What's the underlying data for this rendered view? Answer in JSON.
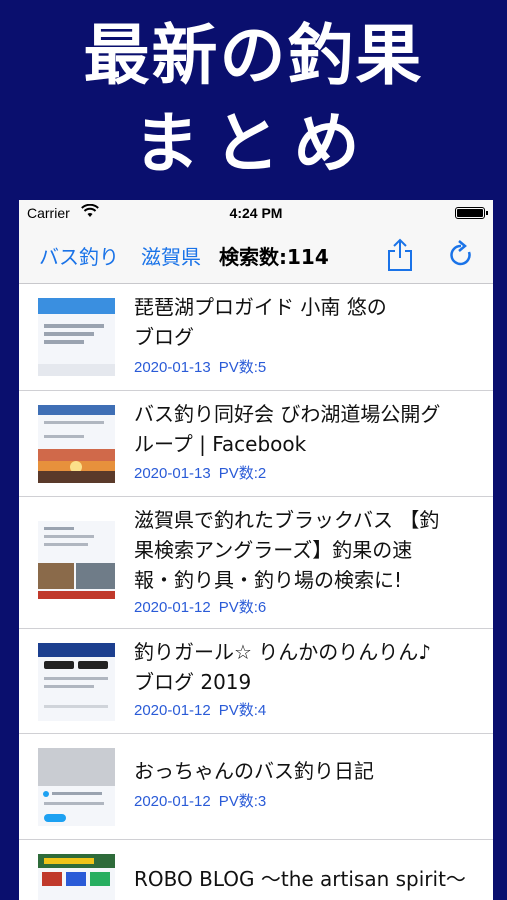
{
  "promo": {
    "line1": "最新の釣果",
    "line2": "まとめ"
  },
  "status_bar": {
    "carrier": "Carrier",
    "time": "4:24 PM"
  },
  "nav": {
    "category": "バス釣り",
    "prefecture": "滋賀県",
    "count_label": "検索数:114"
  },
  "results": [
    {
      "title_lines": [
        "琵琶湖プロガイド 小南 悠の",
        "ブログ"
      ],
      "date": "2020-01-13",
      "pv": "PV数:5",
      "thumb": "app-screenshot"
    },
    {
      "title_lines": [
        "バス釣り同好会 びわ湖道場公開グ",
        "ループ | Facebook"
      ],
      "date": "2020-01-13",
      "pv": "PV数:2",
      "thumb": "sunset"
    },
    {
      "title_lines": [
        "滋賀県で釣れたブラックバス 【釣",
        "果検索アングラーズ】釣果の速",
        "報・釣り具・釣り場の検索に!"
      ],
      "date": "2020-01-12",
      "pv": "PV数:6",
      "thumb": "fish-photos"
    },
    {
      "title_lines": [
        "釣りガール☆ りんかのりんりん♪",
        "ブログ 2019"
      ],
      "date": "2020-01-12",
      "pv": "PV数:4",
      "thumb": "app-store"
    },
    {
      "title_lines": [
        "おっちゃんのバス釣り日記"
      ],
      "date": "2020-01-12",
      "pv": "PV数:3",
      "thumb": "twitter"
    },
    {
      "title_lines": [
        "ROBO BLOG ～the artisan spirit～"
      ],
      "date": "",
      "pv": "",
      "thumb": "blog-banner"
    }
  ],
  "colors": {
    "background": "#0a0f6e",
    "link_blue": "#1a73e8",
    "meta_blue": "#2a5bd7"
  },
  "icons": [
    "wifi-icon",
    "battery-icon",
    "share-icon",
    "refresh-icon"
  ]
}
